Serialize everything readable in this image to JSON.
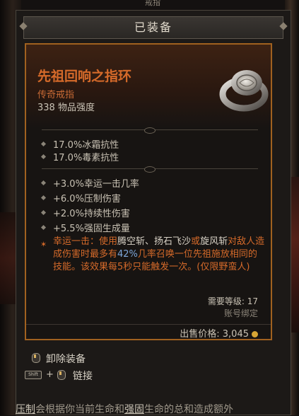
{
  "top_tab": "戒指",
  "header": {
    "title": "已装备"
  },
  "item": {
    "name": "先祖回响之指环",
    "type": "传奇戒指",
    "power": "338 物品强度",
    "implicit": [
      "17.0%冰霜抗性",
      "17.0%毒素抗性"
    ],
    "affixes": [
      "+3.0%幸运一击几率",
      "+6.0%压制伤害",
      "+2.0%持续性伤害",
      "+5.5%强固生成量"
    ],
    "aspect": {
      "prefix": "幸运一击：使用",
      "skill1": "腾空斩",
      "sep1": "、",
      "skill2": "扬石飞沙",
      "or": "或",
      "skill3": "旋风斩",
      "line2a": "对敌人造成伤害时最多有",
      "pct": "42%",
      "line2b": "几率召唤一位先祖施放相同的技能。该效果每5秒只能触发一次。(仅限野蛮人)"
    },
    "required_level": "需要等级: 17",
    "bound": "账号绑定",
    "sell_price": "出售价格: 3,045"
  },
  "actions": {
    "unequip": "卸除装备",
    "link": "链接"
  },
  "footer": {
    "word1": "压制",
    "mid": "会根据你当前生命和",
    "word2": "强固",
    "tail": "生命的总和造成额外"
  },
  "colors": {
    "legendary": "#d56a2a",
    "border": "#a0611f",
    "gold": "#d8a634"
  }
}
